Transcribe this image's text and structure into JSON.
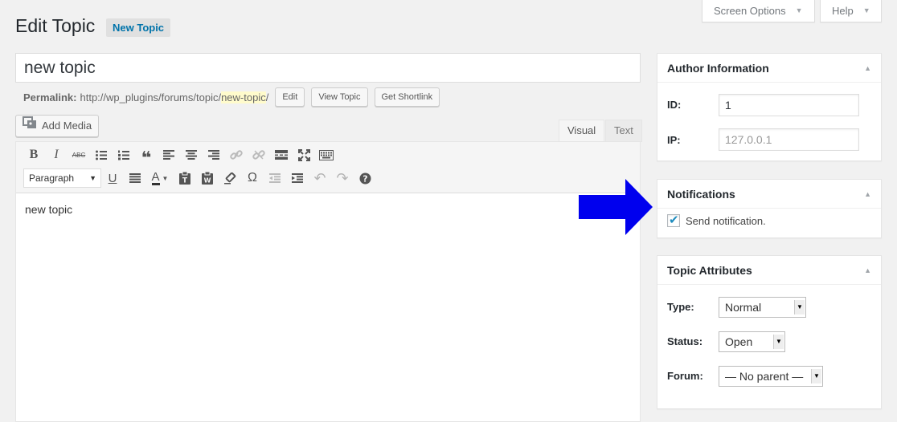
{
  "screen_options": {
    "label": "Screen Options"
  },
  "help": {
    "label": "Help"
  },
  "header": {
    "title": "Edit Topic",
    "add_new": "New Topic"
  },
  "title_input": {
    "value": "new topic"
  },
  "permalink": {
    "label": "Permalink:",
    "base": "http://wp_plugins/forums/topic/",
    "slug": "new-topic",
    "trail": "/",
    "buttons": {
      "edit": "Edit",
      "view": "View Topic",
      "shortlink": "Get Shortlink"
    }
  },
  "editor": {
    "add_media": "Add Media",
    "tabs": {
      "visual": "Visual",
      "text": "Text"
    },
    "format_select": "Paragraph",
    "content": "new topic"
  },
  "author_box": {
    "title": "Author Information",
    "id_label": "ID:",
    "id_value": "1",
    "ip_label": "IP:",
    "ip_value": "127.0.0.1"
  },
  "notifications_box": {
    "title": "Notifications",
    "checkbox_label": "Send notification.",
    "checked": true
  },
  "attributes_box": {
    "title": "Topic Attributes",
    "type_label": "Type:",
    "type_value": "Normal",
    "status_label": "Status:",
    "status_value": "Open",
    "forum_label": "Forum:",
    "forum_value": "— No parent —"
  },
  "colors": {
    "arrow": "#0000ee",
    "link": "#0073aa",
    "slug_highlight": "#fffbcc"
  }
}
